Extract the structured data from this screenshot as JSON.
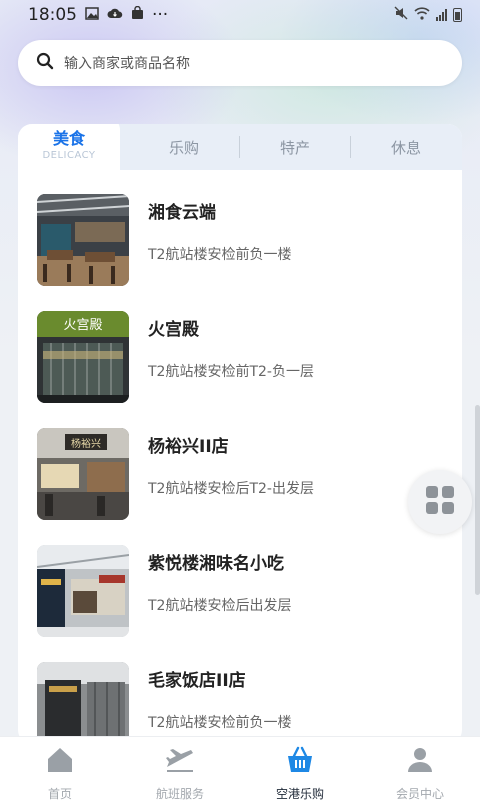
{
  "status_bar": {
    "time": "18:05",
    "more": "···"
  },
  "search": {
    "placeholder": "输入商家或商品名称"
  },
  "tabs": [
    {
      "label": "美食",
      "sublabel": "DELICACY",
      "active": true
    },
    {
      "label": "乐购"
    },
    {
      "label": "特产"
    },
    {
      "label": "休息"
    }
  ],
  "stores": [
    {
      "name": "湘食云端",
      "location": "T2航站楼安检前负一楼"
    },
    {
      "name": "火宫殿",
      "location": "T2航站楼安检前T2-负一层",
      "sign_text": "火宫殿"
    },
    {
      "name": "杨裕兴II店",
      "location": "T2航站楼安检后T2-出发层",
      "sign_text": "杨裕兴"
    },
    {
      "name": "紫悦楼湘味名小吃",
      "location": "T2航站楼安检后出发层"
    },
    {
      "name": "毛家饭店II店",
      "location": "T2航站楼安检前负一楼"
    }
  ],
  "bottom_nav": [
    {
      "label": "首页",
      "icon": "home-icon"
    },
    {
      "label": "航班服务",
      "icon": "airplane-icon"
    },
    {
      "label": "空港乐购",
      "icon": "basket-icon",
      "active": true
    },
    {
      "label": "会员中心",
      "icon": "user-icon"
    }
  ],
  "colors": {
    "accent": "#1a73e8",
    "active_nav": "#1e88e5"
  }
}
